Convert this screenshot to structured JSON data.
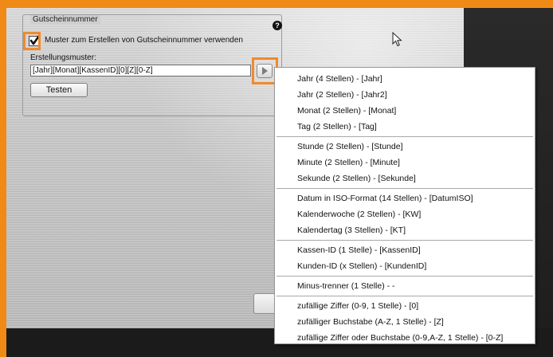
{
  "group": {
    "title": "Gutscheinnummer",
    "help_icon": "?",
    "checkbox_checked": true,
    "checkbox_label": "Muster zum Erstellen von Gutscheinnummer verwenden",
    "pattern_label": "Erstellungsmuster:",
    "pattern_value": "[Jahr][Monat][KassenID][0][Z][0-Z]",
    "test_button": "Testen"
  },
  "menu": {
    "items": [
      "Jahr (4 Stellen) - [Jahr]",
      "Jahr (2 Stellen) - [Jahr2]",
      "Monat (2 Stellen) - [Monat]",
      "Tag (2 Stellen) - [Tag]",
      "Stunde (2 Stellen) - [Stunde]",
      "Minute (2 Stellen) - [Minute]",
      "Sekunde (2 Stellen) - [Sekunde]",
      "Datum in ISO-Format (14 Stellen) - [DatumISO]",
      "Kalenderwoche (2 Stellen) - [KW]",
      "Kalendertag (3 Stellen) - [KT]",
      "Kassen-ID (1 Stelle) - [KassenID]",
      "Kunden-ID (x Stellen) - [KundenID]",
      "Minus-trenner (1 Stelle) - -",
      "zufällige Ziffer (0-9, 1 Stelle) - [0]",
      "zufälliger Buchstabe (A-Z, 1 Stelle) - [Z]",
      "zufällige Ziffer oder Buchstabe (0-9,A-Z, 1 Stelle) - [0-Z]"
    ]
  },
  "colors": {
    "highlight": "#ef8a2e",
    "outer_border": "#f08a16"
  }
}
